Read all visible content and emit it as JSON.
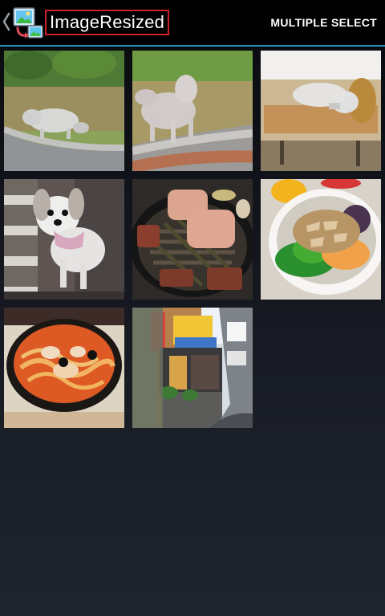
{
  "header": {
    "title": "ImageResized",
    "multiple_select_label": "MULTIPLE SELECT",
    "up_icon": "chevron-left-icon",
    "app_icon": "image-resize-app-icon",
    "accent_color": "#2aa7d6",
    "highlight_color": "#cf1f2b"
  },
  "gallery": {
    "items": [
      {
        "name": "photo-dog-sniffing-grass"
      },
      {
        "name": "photo-dog-walking-path"
      },
      {
        "name": "photo-dog-on-sofa"
      },
      {
        "name": "photo-dog-standing-porch"
      },
      {
        "name": "photo-grilled-meat"
      },
      {
        "name": "photo-salad-bowl"
      },
      {
        "name": "photo-spicy-pasta-pot"
      },
      {
        "name": "photo-restaurant-storefront"
      }
    ]
  }
}
